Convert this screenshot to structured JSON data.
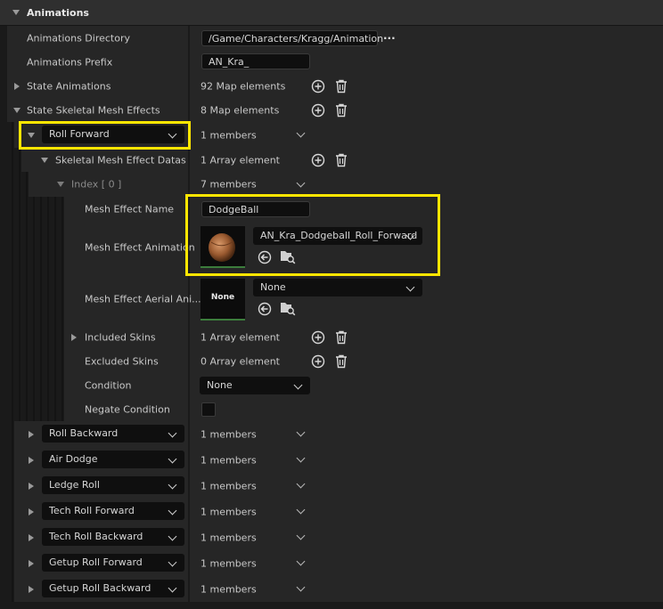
{
  "header": {
    "title": "Animations"
  },
  "rows": {
    "dir_label": "Animations Directory",
    "dir_value": "/Game/Characters/Kragg/Animation",
    "browse": "...",
    "prefix_label": "Animations Prefix",
    "prefix_value": "AN_Kra_",
    "state_anims_label": "State Animations",
    "state_anims_value": "92 Map elements",
    "skel_effects_label": "State Skeletal Mesh Effects",
    "skel_effects_value": "8 Map elements",
    "roll_forward_key": "Roll Forward",
    "roll_forward_value": "1 members",
    "effect_datas_label": "Skeletal Mesh Effect Datas",
    "effect_datas_value": "1 Array element",
    "index_label": "Index [ 0 ]",
    "index_value": "7 members",
    "mesh_name_label": "Mesh Effect Name",
    "mesh_name_value": "DodgeBall",
    "mesh_anim_label": "Mesh Effect Animation",
    "mesh_anim_value": "AN_Kra_Dodgeball_Roll_Forward",
    "aerial_label": "Mesh Effect Aerial Ani...",
    "aerial_thumb": "None",
    "aerial_value": "None",
    "included_label": "Included Skins",
    "included_value": "1 Array element",
    "excluded_label": "Excluded Skins",
    "excluded_value": "0 Array element",
    "condition_label": "Condition",
    "condition_value": "None",
    "negate_label": "Negate Condition"
  },
  "map_entries": [
    {
      "key": "Roll Backward",
      "value": "1 members"
    },
    {
      "key": "Air Dodge",
      "value": "1 members"
    },
    {
      "key": "Ledge Roll",
      "value": "1 members"
    },
    {
      "key": "Tech Roll Forward",
      "value": "1 members"
    },
    {
      "key": "Tech Roll Backward",
      "value": "1 members"
    },
    {
      "key": "Getup Roll Forward",
      "value": "1 members"
    },
    {
      "key": "Getup Roll Backward",
      "value": "1 members"
    }
  ],
  "colors": {
    "highlight": "#ffe600",
    "panel": "#262626",
    "field": "#0f0f0f"
  },
  "icons": [
    "expand-arrow-icon",
    "add-element-icon",
    "delete-icon",
    "dropdown-chevron-icon",
    "use-selected-icon",
    "browse-asset-icon",
    "ellipsis-icon"
  ]
}
